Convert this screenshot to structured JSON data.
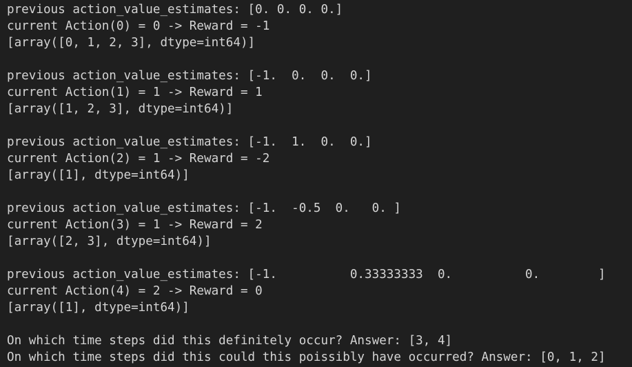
{
  "output": {
    "lines": [
      "previous action_value_estimates: [0. 0. 0. 0.]",
      "current Action(0) = 0 -> Reward = -1",
      "[array([0, 1, 2, 3], dtype=int64)]",
      "",
      "previous action_value_estimates: [-1.  0.  0.  0.]",
      "current Action(1) = 1 -> Reward = 1",
      "[array([1, 2, 3], dtype=int64)]",
      "",
      "previous action_value_estimates: [-1.  1.  0.  0.]",
      "current Action(2) = 1 -> Reward = -2",
      "[array([1], dtype=int64)]",
      "",
      "previous action_value_estimates: [-1.  -0.5  0.   0. ]",
      "current Action(3) = 1 -> Reward = 2",
      "[array([2, 3], dtype=int64)]",
      "",
      "previous action_value_estimates: [-1.          0.33333333  0.          0.        ]",
      "current Action(4) = 2 -> Reward = 0",
      "[array([1], dtype=int64)]",
      "",
      "On which time steps did this definitely occur? Answer: [3, 4]",
      "On which time steps did this could this poissibly have occurred? Answer: [0, 1, 2]"
    ]
  }
}
